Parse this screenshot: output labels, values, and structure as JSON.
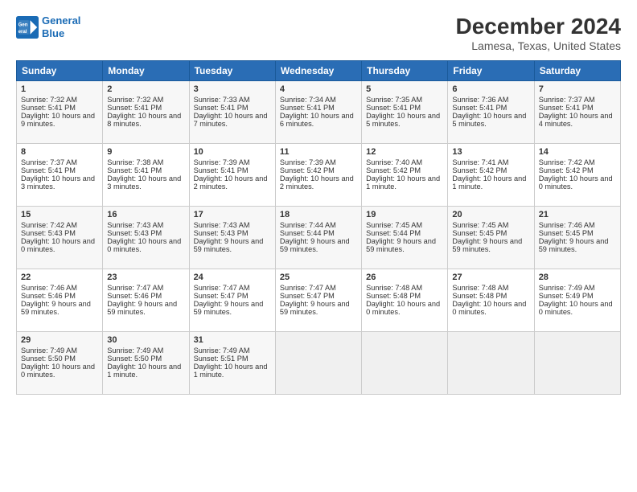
{
  "header": {
    "logo_line1": "General",
    "logo_line2": "Blue",
    "month": "December 2024",
    "location": "Lamesa, Texas, United States"
  },
  "days_of_week": [
    "Sunday",
    "Monday",
    "Tuesday",
    "Wednesday",
    "Thursday",
    "Friday",
    "Saturday"
  ],
  "weeks": [
    [
      {
        "day": 1,
        "rise": "7:32 AM",
        "set": "5:41 PM",
        "daylight": "10 hours and 9 minutes."
      },
      {
        "day": 2,
        "rise": "7:32 AM",
        "set": "5:41 PM",
        "daylight": "10 hours and 8 minutes."
      },
      {
        "day": 3,
        "rise": "7:33 AM",
        "set": "5:41 PM",
        "daylight": "10 hours and 7 minutes."
      },
      {
        "day": 4,
        "rise": "7:34 AM",
        "set": "5:41 PM",
        "daylight": "10 hours and 6 minutes."
      },
      {
        "day": 5,
        "rise": "7:35 AM",
        "set": "5:41 PM",
        "daylight": "10 hours and 5 minutes."
      },
      {
        "day": 6,
        "rise": "7:36 AM",
        "set": "5:41 PM",
        "daylight": "10 hours and 5 minutes."
      },
      {
        "day": 7,
        "rise": "7:37 AM",
        "set": "5:41 PM",
        "daylight": "10 hours and 4 minutes."
      }
    ],
    [
      {
        "day": 8,
        "rise": "7:37 AM",
        "set": "5:41 PM",
        "daylight": "10 hours and 3 minutes."
      },
      {
        "day": 9,
        "rise": "7:38 AM",
        "set": "5:41 PM",
        "daylight": "10 hours and 3 minutes."
      },
      {
        "day": 10,
        "rise": "7:39 AM",
        "set": "5:41 PM",
        "daylight": "10 hours and 2 minutes."
      },
      {
        "day": 11,
        "rise": "7:39 AM",
        "set": "5:42 PM",
        "daylight": "10 hours and 2 minutes."
      },
      {
        "day": 12,
        "rise": "7:40 AM",
        "set": "5:42 PM",
        "daylight": "10 hours and 1 minute."
      },
      {
        "day": 13,
        "rise": "7:41 AM",
        "set": "5:42 PM",
        "daylight": "10 hours and 1 minute."
      },
      {
        "day": 14,
        "rise": "7:42 AM",
        "set": "5:42 PM",
        "daylight": "10 hours and 0 minutes."
      }
    ],
    [
      {
        "day": 15,
        "rise": "7:42 AM",
        "set": "5:43 PM",
        "daylight": "10 hours and 0 minutes."
      },
      {
        "day": 16,
        "rise": "7:43 AM",
        "set": "5:43 PM",
        "daylight": "10 hours and 0 minutes."
      },
      {
        "day": 17,
        "rise": "7:43 AM",
        "set": "5:43 PM",
        "daylight": "9 hours and 59 minutes."
      },
      {
        "day": 18,
        "rise": "7:44 AM",
        "set": "5:44 PM",
        "daylight": "9 hours and 59 minutes."
      },
      {
        "day": 19,
        "rise": "7:45 AM",
        "set": "5:44 PM",
        "daylight": "9 hours and 59 minutes."
      },
      {
        "day": 20,
        "rise": "7:45 AM",
        "set": "5:45 PM",
        "daylight": "9 hours and 59 minutes."
      },
      {
        "day": 21,
        "rise": "7:46 AM",
        "set": "5:45 PM",
        "daylight": "9 hours and 59 minutes."
      }
    ],
    [
      {
        "day": 22,
        "rise": "7:46 AM",
        "set": "5:46 PM",
        "daylight": "9 hours and 59 minutes."
      },
      {
        "day": 23,
        "rise": "7:47 AM",
        "set": "5:46 PM",
        "daylight": "9 hours and 59 minutes."
      },
      {
        "day": 24,
        "rise": "7:47 AM",
        "set": "5:47 PM",
        "daylight": "9 hours and 59 minutes."
      },
      {
        "day": 25,
        "rise": "7:47 AM",
        "set": "5:47 PM",
        "daylight": "9 hours and 59 minutes."
      },
      {
        "day": 26,
        "rise": "7:48 AM",
        "set": "5:48 PM",
        "daylight": "10 hours and 0 minutes."
      },
      {
        "day": 27,
        "rise": "7:48 AM",
        "set": "5:48 PM",
        "daylight": "10 hours and 0 minutes."
      },
      {
        "day": 28,
        "rise": "7:49 AM",
        "set": "5:49 PM",
        "daylight": "10 hours and 0 minutes."
      }
    ],
    [
      {
        "day": 29,
        "rise": "7:49 AM",
        "set": "5:50 PM",
        "daylight": "10 hours and 0 minutes."
      },
      {
        "day": 30,
        "rise": "7:49 AM",
        "set": "5:50 PM",
        "daylight": "10 hours and 1 minute."
      },
      {
        "day": 31,
        "rise": "7:49 AM",
        "set": "5:51 PM",
        "daylight": "10 hours and 1 minute."
      },
      null,
      null,
      null,
      null
    ]
  ]
}
